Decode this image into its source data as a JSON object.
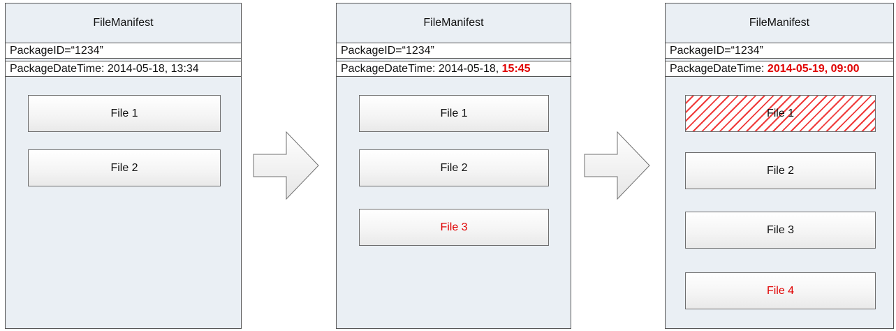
{
  "manifests": [
    {
      "title": "FileManifest",
      "package_id": "PackageID=“1234”",
      "datetime_label": "PackageDateTime: ",
      "datetime_plain": "2014-05-18, 13:34",
      "datetime_changed": "",
      "files": [
        {
          "label": "File 1",
          "status": "unchanged"
        },
        {
          "label": "File 2",
          "status": "unchanged"
        }
      ]
    },
    {
      "title": "FileManifest",
      "package_id": "PackageID=“1234”",
      "datetime_label": "PackageDateTime: ",
      "datetime_plain": "2014-05-18, ",
      "datetime_changed": "15:45",
      "files": [
        {
          "label": "File 1",
          "status": "unchanged"
        },
        {
          "label": "File 2",
          "status": "unchanged"
        },
        {
          "label": "File 3",
          "status": "added"
        }
      ]
    },
    {
      "title": "FileManifest",
      "package_id": "PackageID=“1234”",
      "datetime_label": "PackageDateTime: ",
      "datetime_plain": "",
      "datetime_changed": "2014-05-19, 09:00",
      "files": [
        {
          "label": "File 1",
          "status": "removed"
        },
        {
          "label": "File 2",
          "status": "unchanged"
        },
        {
          "label": "File 3",
          "status": "unchanged"
        },
        {
          "label": "File 4",
          "status": "added"
        }
      ]
    }
  ],
  "colors": {
    "panel_bg": "#eaeff4",
    "highlight": "#e00000",
    "removed_hatch": "#f03a3a"
  }
}
